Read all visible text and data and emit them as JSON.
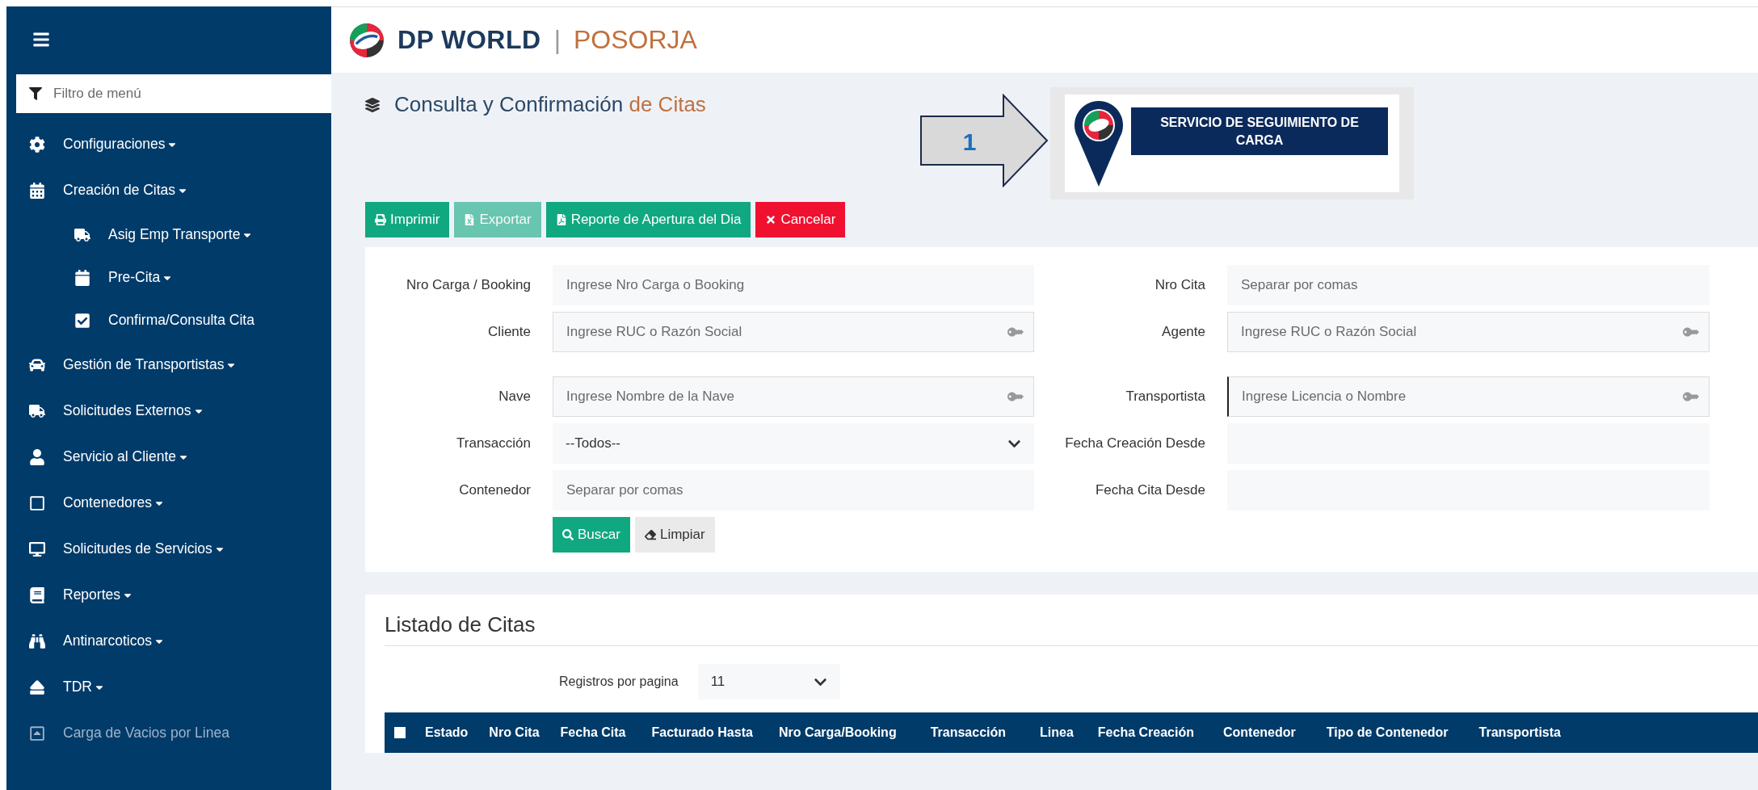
{
  "sidebar": {
    "filter_placeholder": "Filtro de menú",
    "items": [
      {
        "label": "Configuraciones",
        "has_submenu": true,
        "disabled": false
      },
      {
        "label": "Creación de Citas",
        "has_submenu": true,
        "disabled": false,
        "children": [
          {
            "label": "Asig Emp Transporte",
            "has_submenu": true,
            "disabled": false
          },
          {
            "label": "Pre-Cita",
            "has_submenu": true,
            "disabled": false
          },
          {
            "label": "Confirma/Consulta Cita",
            "has_submenu": false,
            "disabled": false
          }
        ]
      },
      {
        "label": "Gestión de Transportistas",
        "has_submenu": true,
        "disabled": false
      },
      {
        "label": "Solicitudes Externos",
        "has_submenu": true,
        "disabled": false
      },
      {
        "label": "Servicio al Cliente",
        "has_submenu": true,
        "disabled": false
      },
      {
        "label": "Contenedores",
        "has_submenu": true,
        "disabled": false
      },
      {
        "label": "Solicitudes de Servicios",
        "has_submenu": true,
        "disabled": false
      },
      {
        "label": "Reportes",
        "has_submenu": true,
        "disabled": false
      },
      {
        "label": "Antinarcoticos",
        "has_submenu": true,
        "disabled": false
      },
      {
        "label": "TDR",
        "has_submenu": true,
        "disabled": false
      },
      {
        "label": "Carga de Vacios por Linea",
        "has_submenu": false,
        "disabled": true
      }
    ]
  },
  "header": {
    "brand": "DP WORLD",
    "separator": "|",
    "site": "POSORJA"
  },
  "page_title": {
    "main": "Consulta y Confirmación",
    "accent": "de Citas"
  },
  "callout": {
    "number": "1",
    "banner": "SERVICIO DE SEGUIMIENTO DE CARGA"
  },
  "toolbar": [
    {
      "label": "Imprimir",
      "kind": "success",
      "disabled": false
    },
    {
      "label": "Exportar",
      "kind": "success",
      "disabled": true
    },
    {
      "label": "Reporte de Apertura del Dia",
      "kind": "success",
      "disabled": false
    },
    {
      "label": "Cancelar",
      "kind": "danger",
      "disabled": false
    }
  ],
  "filters": {
    "left": [
      {
        "label": "Nro Carga / Booking",
        "kind": "text",
        "placeholder": "Ingrese Nro Carga o Booking"
      },
      {
        "label": "Cliente",
        "kind": "lookup",
        "placeholder": "Ingrese RUC o Razón Social"
      },
      {
        "label": "Nave",
        "kind": "lookup",
        "placeholder": "Ingrese Nombre de la Nave"
      },
      {
        "label": "Transacción",
        "kind": "select",
        "value": "--Todos--"
      },
      {
        "label": "Contenedor",
        "kind": "text",
        "placeholder": "Separar por comas"
      }
    ],
    "right": [
      {
        "label": "Nro Cita",
        "kind": "text",
        "placeholder": "Separar por comas"
      },
      {
        "label": "Agente",
        "kind": "lookup",
        "placeholder": "Ingrese RUC o Razón Social"
      },
      {
        "label": "Transportista",
        "kind": "lookup",
        "placeholder": "Ingrese Licencia o Nombre",
        "focused": true
      },
      {
        "label": "Fecha Creación Desde",
        "kind": "text"
      },
      {
        "label": "Fecha Cita Desde",
        "kind": "text"
      }
    ],
    "buttons": [
      {
        "label": "Buscar",
        "kind": "success"
      },
      {
        "label": "Limpiar",
        "kind": "default"
      }
    ]
  },
  "list": {
    "title": "Listado de Citas",
    "page_size_label": "Registros por pagina",
    "page_size": "11",
    "select_all_checked": false,
    "columns": [
      "Estado",
      "Nro Cita",
      "Fecha Cita",
      "Facturado Hasta",
      "Nro Carga/Booking",
      "Transacción",
      "Linea",
      "Fecha Creación",
      "Contenedor",
      "Tipo de Contenedor",
      "Transportista"
    ]
  }
}
